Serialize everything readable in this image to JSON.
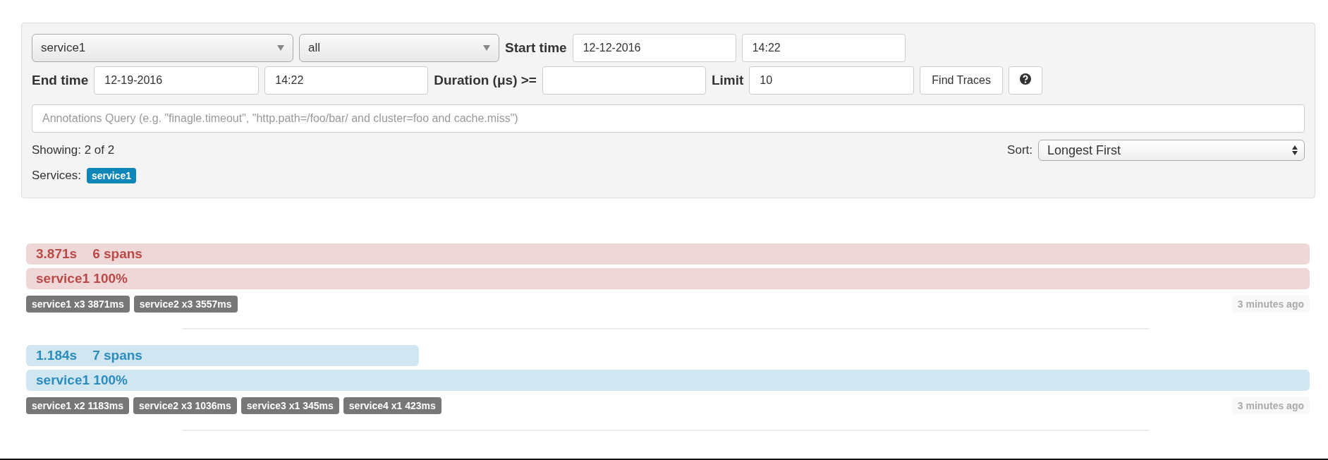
{
  "search": {
    "service_select": {
      "value": "service1"
    },
    "span_select": {
      "value": "all"
    },
    "start_label": "Start time",
    "start_date": {
      "value": "12-12-2016"
    },
    "start_time": {
      "value": "14:22"
    },
    "end_label": "End time",
    "end_date": {
      "value": "12-19-2016"
    },
    "end_time": {
      "value": "14:22"
    },
    "duration_label": "Duration (μs) >=",
    "limit_label": "Limit",
    "limit": {
      "value": "10"
    },
    "find_button": "Find Traces",
    "annotations": {
      "placeholder": "Annotations Query (e.g. \"finagle.timeout\", \"http.path=/foo/bar/ and cluster=foo and cache.miss\")"
    },
    "showing": "Showing: 2 of 2",
    "sort_label": "Sort:",
    "sort": {
      "value": "Longest First"
    },
    "services_label": "Services:",
    "services": [
      "service1"
    ]
  },
  "traces": [
    {
      "duration": "3.871s",
      "spans": "6 spans",
      "color": "#b94a48",
      "service": "service1 100%",
      "tags": [
        "service1 x3 3871ms",
        "service2 x3 3557ms"
      ],
      "time": "3 minutes ago"
    },
    {
      "duration": "1.184s",
      "spans": "7 spans",
      "color": "#2b8cbe",
      "service": "service1 100%",
      "tags": [
        "service1 x2 1183ms",
        "service2 x3 1036ms",
        "service3 x1 345ms",
        "service4 x1 423ms"
      ],
      "time": "3 minutes ago"
    }
  ]
}
